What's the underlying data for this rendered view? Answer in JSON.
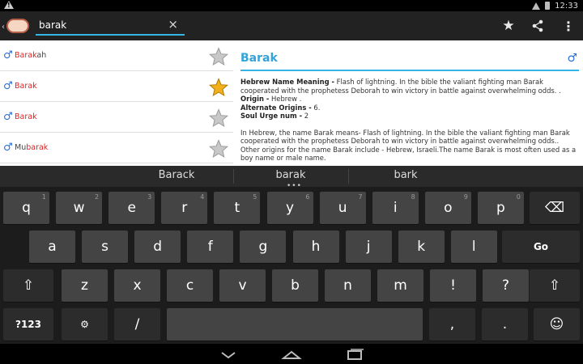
{
  "status": {
    "time": "12:33"
  },
  "search": {
    "value": "barak",
    "placeholder": ""
  },
  "results": [
    {
      "gender": "♂",
      "pre": "",
      "match": "Barak",
      "post": "ah",
      "starred": false
    },
    {
      "gender": "♂",
      "pre": "",
      "match": "Barak",
      "post": "",
      "starred": true
    },
    {
      "gender": "♂",
      "pre": "",
      "match": "Barak",
      "post": "",
      "starred": false
    },
    {
      "gender": "♂",
      "pre": "Mu",
      "match": "barak",
      "post": "",
      "starred": false
    }
  ],
  "detail": {
    "title": "Barak",
    "gender": "♂",
    "meaning_label": "Hebrew Name Meaning -",
    "meaning_text": " Flash of lightning. In the bible the valiant fighting man Barak cooperated with the prophetess Deborah to win victory in battle against overwhelming odds. .",
    "origin_label": "Origin -",
    "origin_text": " Hebrew .",
    "alt_label": "Alternate Origins -",
    "alt_text": " 6.",
    "soul_label": "Soul Urge num -",
    "soul_text": " 2",
    "paragraph": "In Hebrew, the name Barak means- Flash of lightning. In the bible the valiant fighting man Barak cooperated with the prophetess Deborah to win victory in battle against overwhelming odds.. Other origins for the name Barak include - Hebrew, Israeli.The name Barak is most often used as a boy name or male name."
  },
  "keyboard": {
    "suggestions": [
      "Barack",
      "barak",
      "bark"
    ],
    "row1": [
      {
        "k": "q",
        "h": "1"
      },
      {
        "k": "w",
        "h": "2"
      },
      {
        "k": "e",
        "h": "3"
      },
      {
        "k": "r",
        "h": "4"
      },
      {
        "k": "t",
        "h": "5"
      },
      {
        "k": "y",
        "h": "6"
      },
      {
        "k": "u",
        "h": "7"
      },
      {
        "k": "i",
        "h": "8"
      },
      {
        "k": "o",
        "h": "9"
      },
      {
        "k": "p",
        "h": "0"
      }
    ],
    "row2": [
      "a",
      "s",
      "d",
      "f",
      "g",
      "h",
      "j",
      "k",
      "l"
    ],
    "row3": [
      "z",
      "x",
      "c",
      "v",
      "b",
      "n",
      "m",
      "!",
      "?"
    ],
    "go_label": "Go",
    "symbols_label": "?123",
    "settings_label": "⚙",
    "slash_label": "/",
    "comma_label": ",",
    "period_label": ".",
    "emoji_label": "☺",
    "delete_label": "⌫",
    "shift_label": "⇧"
  },
  "icons": {
    "favorite": "star-icon",
    "share": "share-icon",
    "menu": "overflow-menu-icon",
    "clear": "×",
    "menu_glyph": "⋮",
    "star_glyph": "★"
  },
  "colors": {
    "accent": "#33b5e5",
    "highlight": "#e02020",
    "male": "#2a6fd6",
    "star_gold": "#f2b01e"
  }
}
